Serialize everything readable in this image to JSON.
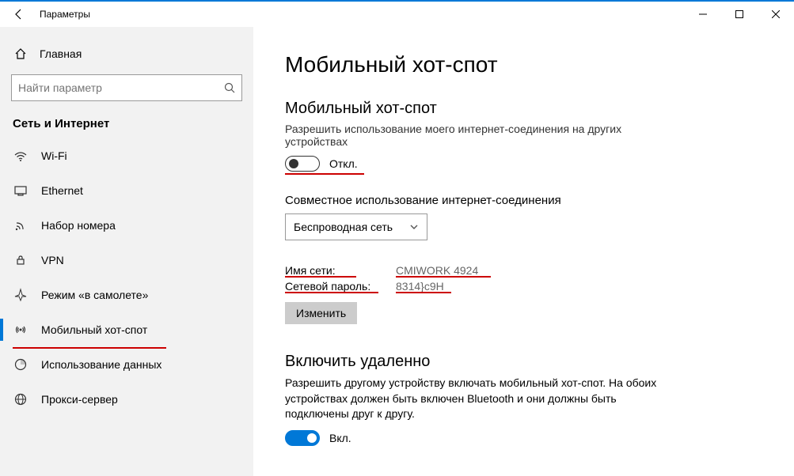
{
  "window": {
    "title": "Параметры"
  },
  "sidebar": {
    "home": "Главная",
    "search_placeholder": "Найти параметр",
    "section": "Сеть и Интернет",
    "items": [
      {
        "label": "Wi-Fi"
      },
      {
        "label": "Ethernet"
      },
      {
        "label": "Набор номера"
      },
      {
        "label": "VPN"
      },
      {
        "label": "Режим «в самолете»"
      },
      {
        "label": "Мобильный хот-спот"
      },
      {
        "label": "Использование данных"
      },
      {
        "label": "Прокси-сервер"
      }
    ]
  },
  "page": {
    "title": "Мобильный хот-спот",
    "hotspot_heading": "Мобильный хот-спот",
    "hotspot_desc": "Разрешить использование моего интернет-соединения на других устройствах",
    "toggle_off_label": "Откл.",
    "share_heading": "Совместное использование интернет-соединения",
    "share_select": "Беспроводная сеть",
    "net_name_label": "Имя сети:",
    "net_name_value": "CMIWORK 4924",
    "net_pass_label": "Сетевой пароль:",
    "net_pass_value": "8314}c9H",
    "edit_button": "Изменить",
    "remote_heading": "Включить удаленно",
    "remote_desc": "Разрешить другому устройству включать мобильный хот-спот. На обоих устройствах должен быть включен Bluetooth и они должны быть подключены друг к другу.",
    "toggle_on_label": "Вкл."
  }
}
